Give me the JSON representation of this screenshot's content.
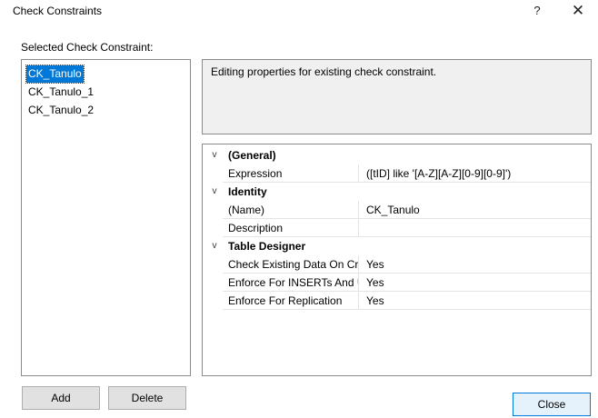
{
  "window": {
    "title": "Check Constraints",
    "help_glyph": "?",
    "close_glyph": "✕"
  },
  "left": {
    "label": "Selected Check Constraint:",
    "items": [
      "CK_Tanulo",
      "CK_Tanulo_1",
      "CK_Tanulo_2"
    ],
    "selected_index": 0
  },
  "description": {
    "text": "Editing properties for existing check constraint."
  },
  "grid": {
    "chevron": "v",
    "categories": [
      {
        "name": "(General)",
        "props": [
          {
            "name": "Expression",
            "value": "([tID] like '[A-Z][A-Z][0-9][0-9]')"
          }
        ]
      },
      {
        "name": "Identity",
        "props": [
          {
            "name": "(Name)",
            "value": "CK_Tanulo"
          },
          {
            "name": "Description",
            "value": ""
          }
        ]
      },
      {
        "name": "Table Designer",
        "props": [
          {
            "name": "Check Existing Data On Cr",
            "value": "Yes"
          },
          {
            "name": "Enforce For INSERTs And U",
            "value": "Yes"
          },
          {
            "name": "Enforce For Replication",
            "value": "Yes"
          }
        ]
      }
    ]
  },
  "buttons": {
    "add": "Add",
    "delete": "Delete",
    "close": "Close"
  }
}
